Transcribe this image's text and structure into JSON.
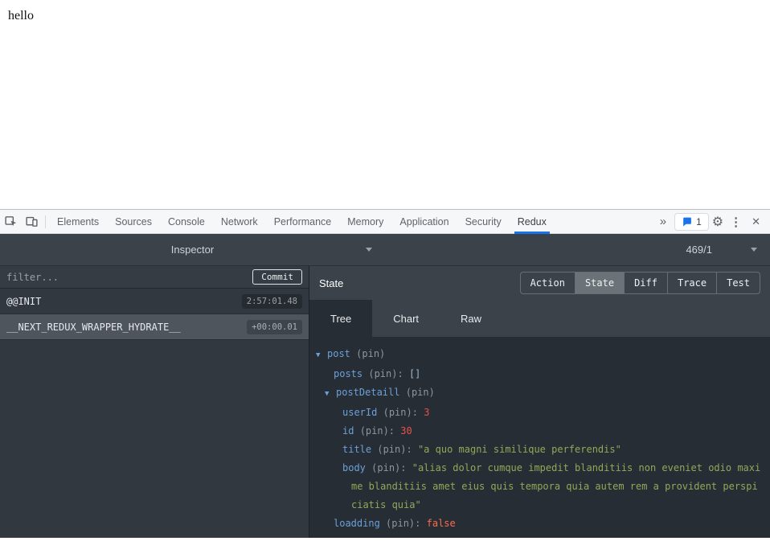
{
  "page": {
    "text": "hello"
  },
  "devtools": {
    "tabbar": {
      "tabs": [
        {
          "label": "Elements"
        },
        {
          "label": "Sources"
        },
        {
          "label": "Console"
        },
        {
          "label": "Network"
        },
        {
          "label": "Performance"
        },
        {
          "label": "Memory"
        },
        {
          "label": "Application"
        },
        {
          "label": "Security"
        },
        {
          "label": "Redux",
          "active": true
        }
      ],
      "more_tabs_glyph": "»",
      "issues_count": "1",
      "icons": {
        "settings_gear": "⚙",
        "menu_dots": "⋮",
        "close": "✕"
      }
    },
    "redux": {
      "toolbar": {
        "monitor_dropdown": "Inspector",
        "instance_dropdown": "469/1"
      },
      "left": {
        "filter_placeholder": "filter...",
        "commit_label": "Commit",
        "actions": [
          {
            "name": "@@INIT",
            "time": "2:57:01.48",
            "selected": false
          },
          {
            "name": "__NEXT_REDUX_WRAPPER_HYDRATE__",
            "time": "+00:00.01",
            "selected": true
          }
        ]
      },
      "right": {
        "title": "State",
        "mode_buttons": [
          {
            "label": "Action"
          },
          {
            "label": "State",
            "active": true
          },
          {
            "label": "Diff"
          },
          {
            "label": "Trace"
          },
          {
            "label": "Test"
          }
        ],
        "view_tabs": [
          {
            "label": "Tree",
            "active": true
          },
          {
            "label": "Chart"
          },
          {
            "label": "Raw"
          }
        ],
        "tree": [
          {
            "indent": 0,
            "expandable": true,
            "key": "post",
            "meta": "(pin)"
          },
          {
            "indent": 1,
            "key": "posts",
            "meta": "(pin):",
            "value": "[]",
            "type": "array"
          },
          {
            "indent": 1,
            "expandable": true,
            "key": "postDetaill",
            "meta": "(pin)"
          },
          {
            "indent": 2,
            "key": "userId",
            "meta": "(pin):",
            "value": "3",
            "type": "number"
          },
          {
            "indent": 2,
            "key": "id",
            "meta": "(pin):",
            "value": "30",
            "type": "number"
          },
          {
            "indent": 2,
            "key": "title",
            "meta": "(pin):",
            "value": "\"a quo magni similique perferendis\"",
            "type": "string"
          },
          {
            "indent": 2,
            "key": "body",
            "meta": "(pin):",
            "value": "\"alias dolor cumque impedit blanditiis non eveniet odio maxime blanditiis amet eius quis tempora quia autem rem a provident perspiciatis quia\"",
            "type": "string"
          },
          {
            "indent": 1,
            "key": "loadding",
            "meta": "(pin):",
            "value": "false",
            "type": "boolean"
          }
        ]
      }
    }
  },
  "colors": {
    "accent": "#1a73e8",
    "tree_key": "#6ba1d8",
    "tree_string": "#90a959",
    "tree_number": "#e5534b",
    "tree_boolean": "#fc6d4c"
  }
}
